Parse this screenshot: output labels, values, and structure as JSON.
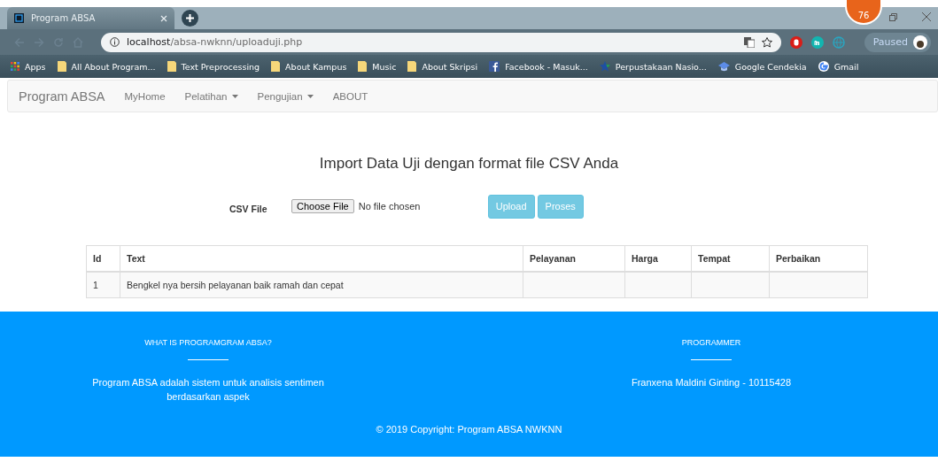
{
  "browser": {
    "tab_title": "Program ABSA",
    "badge": "76",
    "url_host": "localhost",
    "url_path": "/absa-nwknn/uploaduji.php",
    "profile": "Paused",
    "bookmarks": [
      {
        "label": "Apps",
        "kind": "apps"
      },
      {
        "label": "All About Program...",
        "kind": "folder"
      },
      {
        "label": "Text Preprocessing",
        "kind": "folder"
      },
      {
        "label": "About Kampus",
        "kind": "folder"
      },
      {
        "label": "Music",
        "kind": "folder"
      },
      {
        "label": "About Skripsi",
        "kind": "folder"
      },
      {
        "label": "Facebook - Masuk...",
        "kind": "facebook"
      },
      {
        "label": "Perpustakaan Nasio...",
        "kind": "star"
      },
      {
        "label": "Google Cendekia",
        "kind": "cap"
      },
      {
        "label": "Gmail",
        "kind": "google"
      }
    ]
  },
  "navbar": {
    "brand": "Program ABSA",
    "items": [
      {
        "label": "MyHome",
        "dropdown": false
      },
      {
        "label": "Pelatihan",
        "dropdown": true
      },
      {
        "label": "Pengujian",
        "dropdown": true
      },
      {
        "label": "ABOUT",
        "dropdown": false
      }
    ]
  },
  "heading": "Import Data Uji dengan format file CSV Anda",
  "form": {
    "label": "CSV File",
    "choose_button": "Choose File",
    "file_status": "No file chosen",
    "buttons": [
      "Upload",
      "Proses"
    ]
  },
  "table": {
    "columns": [
      "Id",
      "Text",
      "Pelayanan",
      "Harga",
      "Tempat",
      "Perbaikan"
    ],
    "rows": [
      [
        "1",
        "Bengkel nya bersih pelayanan baik ramah dan cepat",
        "",
        "",
        "",
        ""
      ]
    ]
  },
  "footer": {
    "sections": [
      {
        "title": "WHAT IS PROGRAMGRAM ABSA?",
        "text": "Program ABSA adalah sistem untuk analisis sentimen berdasarkan aspek"
      },
      {
        "title": "PROGRAMMER",
        "text": "Franxena Maldini Ginting - 10115428"
      }
    ],
    "copyright": "© 2019 Copyright: Program ABSA NWKNN"
  }
}
